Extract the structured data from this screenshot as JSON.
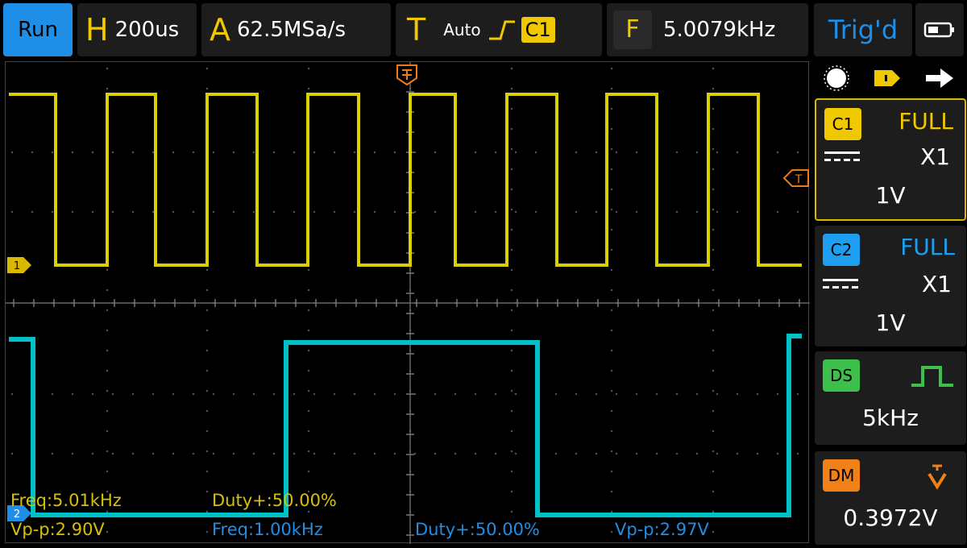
{
  "topbar": {
    "run": "Run",
    "h_letter": "H",
    "h_value": "200us",
    "a_letter": "A",
    "a_value": "62.5MSa/s",
    "t_letter": "T",
    "t_mode": "Auto",
    "t_source": "C1",
    "f_letter": "F",
    "f_value": "5.0079kHz",
    "status": "Trig'd"
  },
  "readouts": {
    "ch1_freq": "Freq:5.01kHz",
    "ch1_duty": "Duty+:50.00%",
    "ch1_vpp": "Vp-p:2.90V",
    "ch2_freq": "Freq:1.00kHz",
    "ch2_duty": "Duty+:50.00%",
    "ch2_vpp": "Vp-p:2.97V"
  },
  "markers": {
    "ch1": "1",
    "ch2": "2",
    "trig_level": "T"
  },
  "channels": [
    {
      "tag": "C1",
      "mode": "FULL",
      "probe": "X1",
      "scale": "1V",
      "color": "#f0c800"
    },
    {
      "tag": "C2",
      "mode": "FULL",
      "probe": "X1",
      "scale": "1V",
      "color": "#1e9ef0"
    }
  ],
  "ds": {
    "tag": "DS",
    "value": "5kHz",
    "color": "#3cc04a"
  },
  "dm": {
    "tag": "DM",
    "value": "0.3972V",
    "color": "#f08018"
  },
  "colors": {
    "ch1": "#d8d000",
    "ch2": "#00c0c8",
    "accent": "#1e8ee6",
    "trigger": "#f07a18"
  }
}
